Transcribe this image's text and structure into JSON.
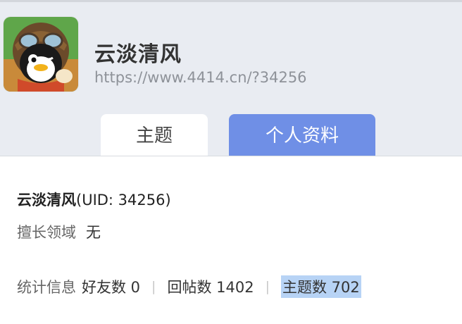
{
  "user": {
    "name": "云淡清风",
    "url": "https://www.4414.cn/?34256"
  },
  "tabs": [
    {
      "label": "主题"
    },
    {
      "label": "个人资料"
    }
  ],
  "profile": {
    "title_name": "云淡清风",
    "title_uid": "(UID: 34256)",
    "expertise_label": "擅长领域",
    "expertise_value": "无",
    "stats_label": "统计信息",
    "friends": "好友数 0",
    "replies": "回帖数 1402",
    "topics": "主题数 702",
    "separator": "|"
  },
  "icons": {
    "avatar": "penguin-pilot-avatar"
  },
  "colors": {
    "header_bg": "#e9ecf2",
    "active_tab": "#6f8fe6",
    "selection_highlight": "#b7d3f5"
  }
}
